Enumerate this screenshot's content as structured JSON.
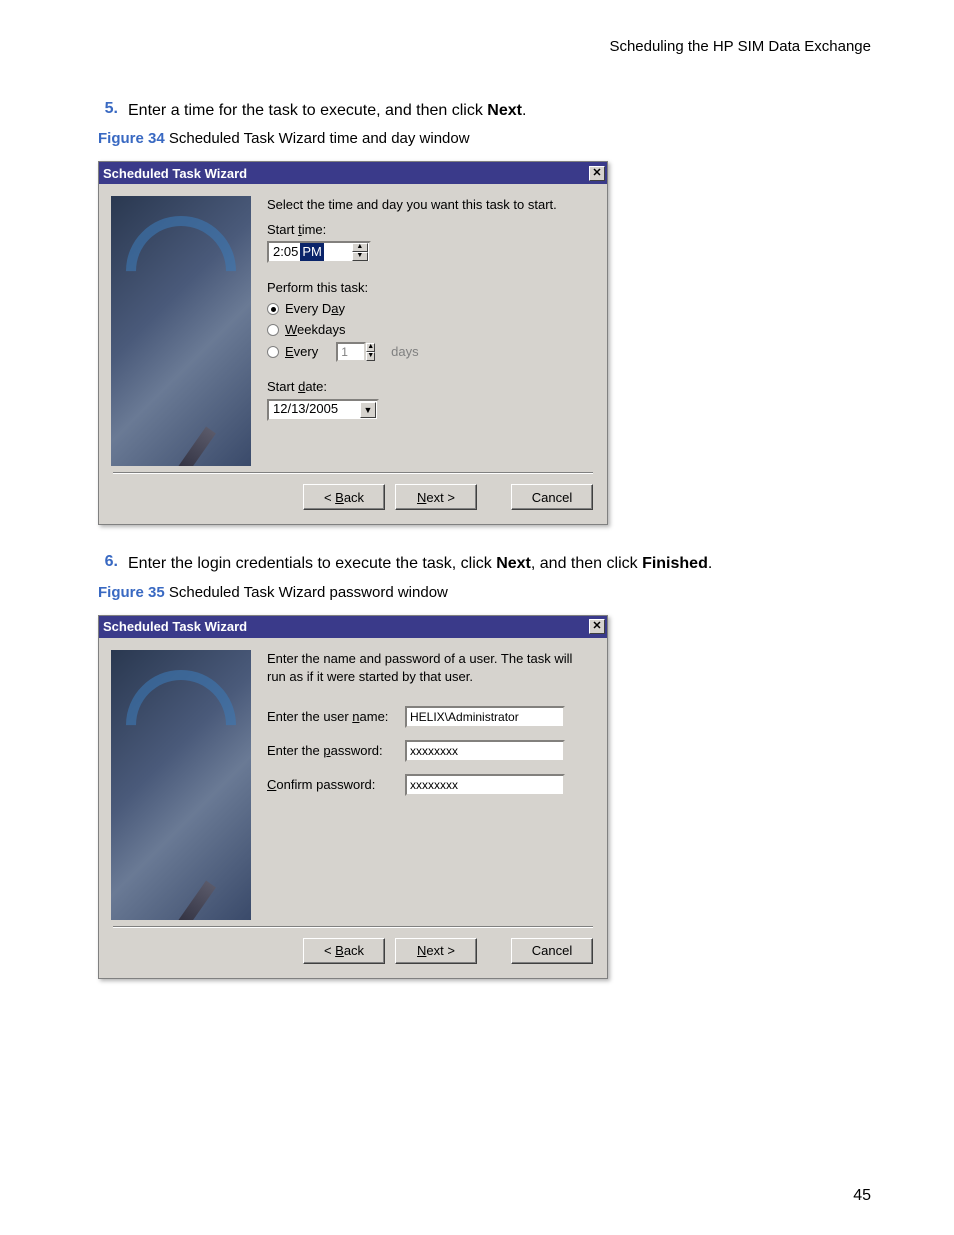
{
  "header": "Scheduling the HP SIM Data Exchange",
  "page_number": "45",
  "step5": {
    "num": "5.",
    "text_before": "Enter a time for the task to execute, and then click ",
    "bold": "Next",
    "text_after": "."
  },
  "figure34": {
    "label": "Figure 34",
    "caption": " Scheduled Task Wizard time and day window"
  },
  "dialog1": {
    "title": "Scheduled Task Wizard",
    "intro": "Select the time and day you want this task to start.",
    "start_time_label_pre": "Start ",
    "start_time_label_und": "t",
    "start_time_label_post": "ime:",
    "time_value": "2:05",
    "time_ampm": "PM",
    "perform_label": "Perform this task:",
    "radio1_pre": "Every D",
    "radio1_und": "a",
    "radio1_post": "y",
    "radio2_und": "W",
    "radio2_post": "eekdays",
    "radio3_und": "E",
    "radio3_post": "very",
    "every_value": "1",
    "days_label": "days",
    "start_date_label_pre": "Start ",
    "start_date_label_und": "d",
    "start_date_label_post": "ate:",
    "date_value": "12/13/2005",
    "back_pre": "< ",
    "back_und": "B",
    "back_post": "ack",
    "next_und": "N",
    "next_post": "ext >",
    "cancel": "Cancel"
  },
  "step6": {
    "num": "6.",
    "text_before": "Enter the login credentials to execute the task, click ",
    "bold1": "Next",
    "text_mid": ", and then click ",
    "bold2": "Finished",
    "text_after": "."
  },
  "figure35": {
    "label": "Figure 35",
    "caption": " Scheduled Task Wizard password window"
  },
  "dialog2": {
    "title": "Scheduled Task Wizard",
    "intro": "Enter the name and password of a user.  The task will run as if it were started by that user.",
    "username_label_pre": "Enter the user ",
    "username_label_und": "n",
    "username_label_post": "ame:",
    "username_value": "HELIX\\Administrator",
    "password_label_pre": "Enter the ",
    "password_label_und": "p",
    "password_label_post": "assword:",
    "password_value": "xxxxxxxx",
    "confirm_label_und": "C",
    "confirm_label_post": "onfirm password:",
    "confirm_value": "xxxxxxxx",
    "back_pre": "< ",
    "back_und": "B",
    "back_post": "ack",
    "next_und": "N",
    "next_post": "ext >",
    "cancel": "Cancel"
  }
}
